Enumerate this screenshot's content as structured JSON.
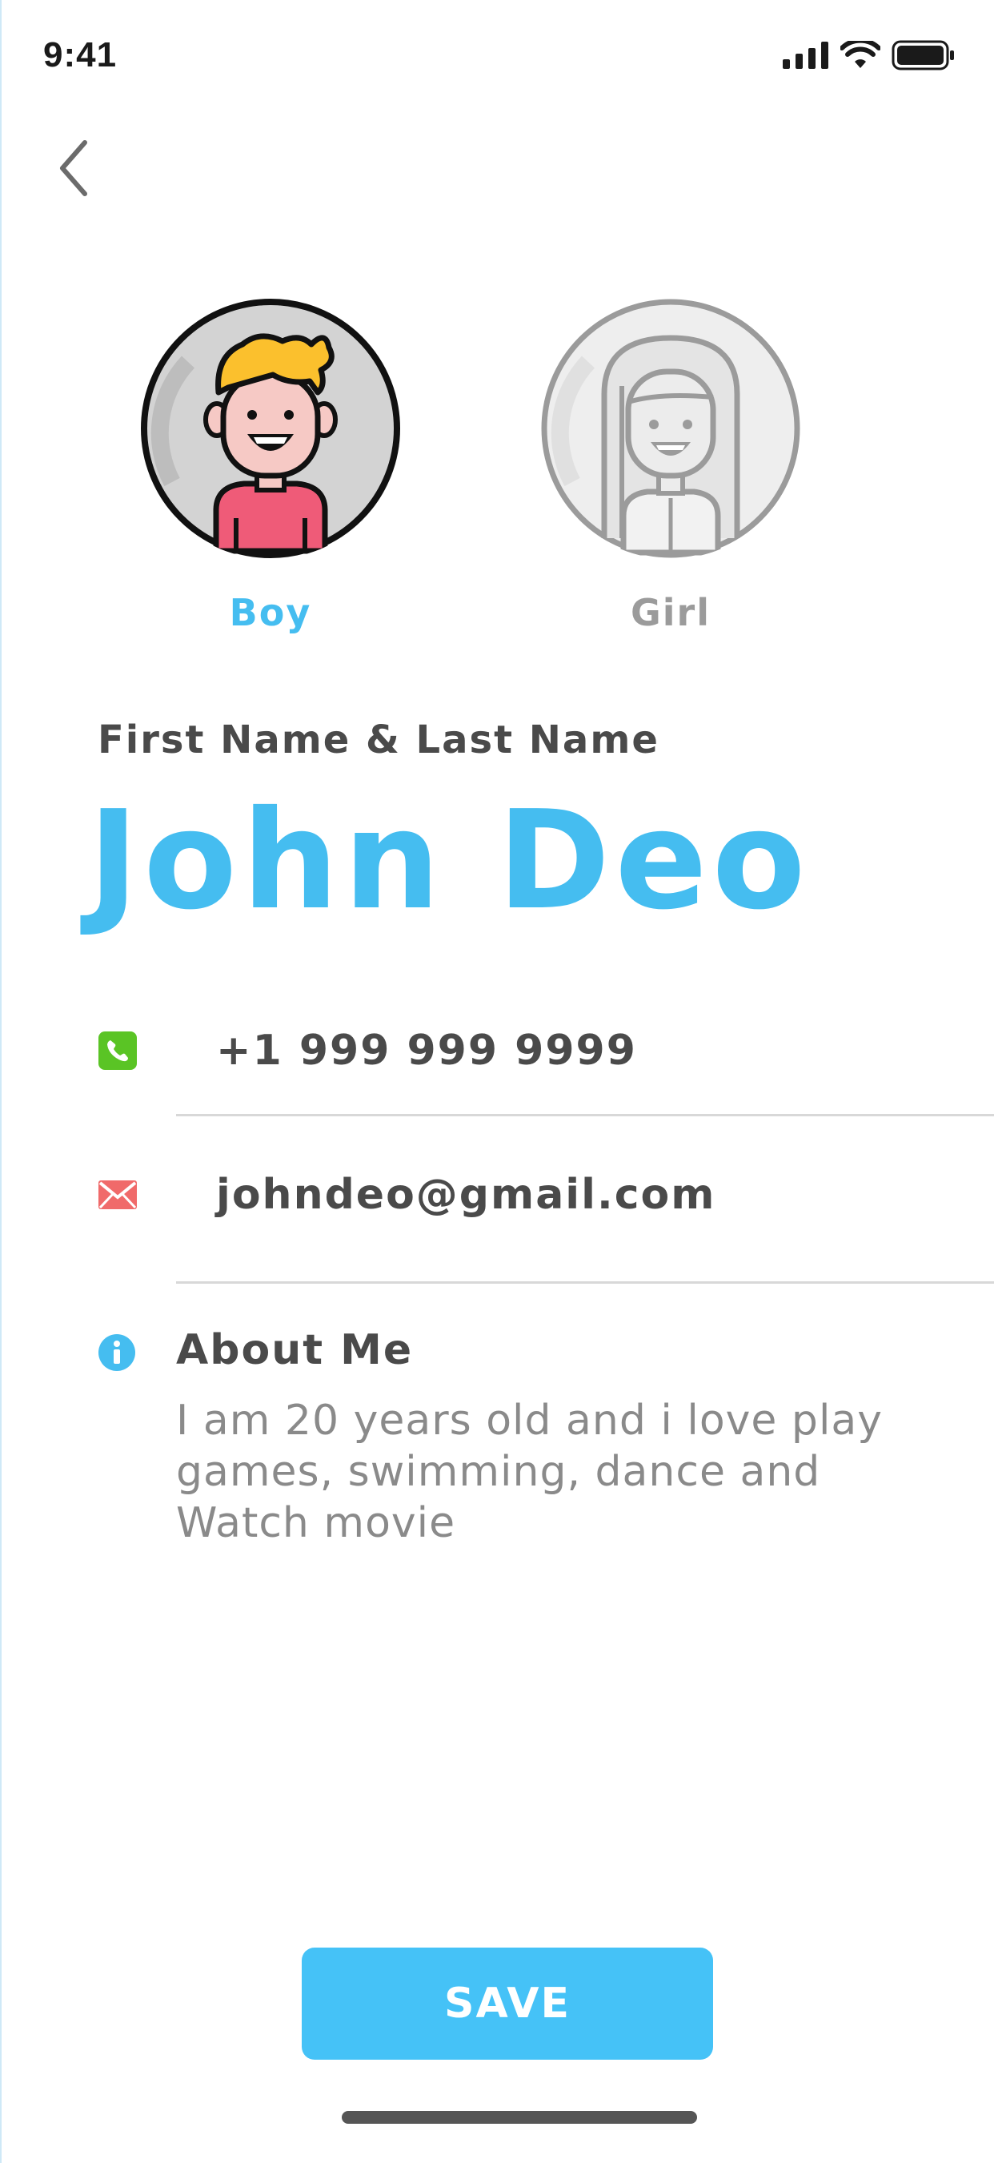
{
  "status_bar": {
    "time": "9:41",
    "signal_icon": "cellular-signal-icon",
    "wifi_icon": "wifi-icon",
    "battery_icon": "battery-icon"
  },
  "navigation": {
    "back_icon": "chevron-left-icon"
  },
  "gender": {
    "options": [
      {
        "label": "Boy",
        "selected": true,
        "icon": "boy-avatar-icon"
      },
      {
        "label": "Girl",
        "selected": false,
        "icon": "girl-avatar-icon"
      }
    ]
  },
  "name": {
    "label": "First Name & Last Name",
    "value": "John Deo"
  },
  "phone": {
    "icon": "phone-icon",
    "value": "+1 999 999 9999"
  },
  "email": {
    "icon": "mail-icon",
    "value": "johndeo@gmail.com"
  },
  "about": {
    "icon": "info-icon",
    "title": "About Me",
    "text": "I am 20 years old and i love play games, swimming, dance and Watch movie"
  },
  "actions": {
    "save_label": "SAVE"
  },
  "colors": {
    "accent": "#45bdf0",
    "button": "#45c2f7",
    "phone_icon": "#5ac425",
    "mail_icon": "#f06a6a",
    "text_dark": "#4a4a4a",
    "text_muted": "#8a8a8a",
    "unselected": "#9b9b9b"
  }
}
